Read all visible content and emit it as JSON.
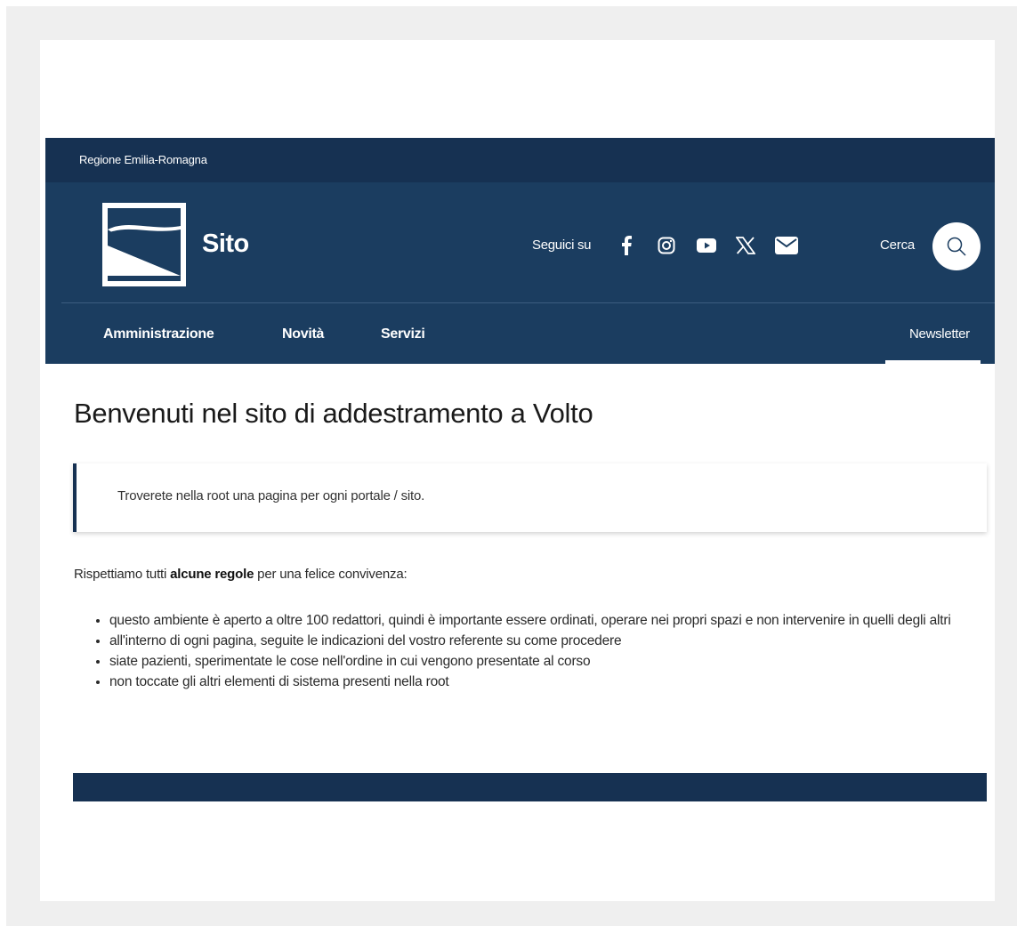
{
  "top_bar": {
    "region_name": "Regione Emilia-Romagna"
  },
  "header": {
    "site_name": "Sito",
    "follow_label": "Seguici su",
    "social_icons": [
      "facebook-icon",
      "instagram-icon",
      "youtube-icon",
      "x-icon",
      "mail-icon"
    ],
    "search_label": "Cerca"
  },
  "nav": {
    "items": [
      {
        "label": "Amministrazione"
      },
      {
        "label": "Novità"
      },
      {
        "label": "Servizi"
      }
    ],
    "newsletter_label": "Newsletter"
  },
  "main": {
    "title": "Benvenuti nel sito di addestramento a Volto",
    "callout": "Troverete nella root una pagina per ogni portale / sito.",
    "intro_before": "Rispettiamo tutti ",
    "intro_bold": "alcune regole",
    "intro_after": " per una felice convivenza:",
    "rules": [
      "questo ambiente è aperto a oltre 100 redattori, quindi è importante essere ordinati, operare nei propri spazi e non intervenire in quelli degli altri",
      "all'interno di ogni pagina, seguite le indicazioni del vostro referente su come procedere",
      "siate pazienti, sperimentate le cose nell'ordine in cui vengono presentate al corso",
      "non toccate gli altri elementi di sistema presenti nella root"
    ]
  },
  "colors": {
    "top_bar_bg": "#163152",
    "header_bg": "#1b3d60",
    "frame_bg": "#efefef"
  }
}
